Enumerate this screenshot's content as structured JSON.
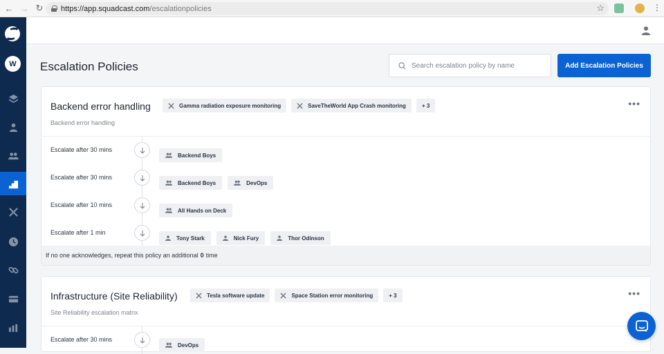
{
  "browser": {
    "url_host": "https://app.squadcast.com",
    "url_path": "/escalationpolicies"
  },
  "sidebar": {
    "workspace_initial": "W",
    "items": [
      {
        "icon": "layers-icon",
        "active": false
      },
      {
        "icon": "user-icon",
        "active": false
      },
      {
        "icon": "users-icon",
        "active": false
      },
      {
        "icon": "stairs-icon",
        "active": true
      },
      {
        "icon": "tools-icon",
        "active": false
      },
      {
        "icon": "clock-icon",
        "active": false
      },
      {
        "icon": "link-icon",
        "active": false
      },
      {
        "icon": "card-icon",
        "active": false
      },
      {
        "icon": "analytics-icon",
        "active": false
      }
    ]
  },
  "header": {
    "title": "Escalation Policies",
    "search_placeholder": "Search escalation policy by name",
    "add_button": "Add Escalation Policies"
  },
  "policies": [
    {
      "name": "Backend error handling",
      "description": "Backend error handling",
      "services": [
        "Gamma radiation exposure monitoring",
        "SaveTheWorld App Crash monitoring"
      ],
      "more_services": "+ 3",
      "rules": [
        {
          "label": "Escalate after 30 mins",
          "targets": [
            {
              "type": "squad",
              "name": "Backend Boys"
            }
          ]
        },
        {
          "label": "Escalate after 30 mins",
          "targets": [
            {
              "type": "squad",
              "name": "Backend Boys"
            },
            {
              "type": "squad",
              "name": "DevOps"
            }
          ]
        },
        {
          "label": "Escalate after 10 mins",
          "targets": [
            {
              "type": "squad",
              "name": "All Hands on Deck"
            }
          ]
        },
        {
          "label": "Escalate after 1 min",
          "targets": [
            {
              "type": "user",
              "name": "Tony Stark"
            },
            {
              "type": "user",
              "name": "Nick Fury"
            },
            {
              "type": "user",
              "name": "Thor Odinson"
            }
          ]
        }
      ],
      "repeat_prefix": "If no one acknowledges, repeat this policy an additional",
      "repeat_count": "0",
      "repeat_suffix": "time"
    },
    {
      "name": "Infrastructure (Site Reliability)",
      "description": "Site Reliability escalation matrix",
      "services": [
        "Tesla software update",
        "Space Station error monitoring"
      ],
      "more_services": "+ 3",
      "rules": [
        {
          "label": "Escalate after 30 mins",
          "targets": [
            {
              "type": "squad",
              "name": "DevOps"
            }
          ]
        }
      ]
    }
  ],
  "colors": {
    "sidebar": "#0f2a4f",
    "accent": "#0a62d3"
  }
}
